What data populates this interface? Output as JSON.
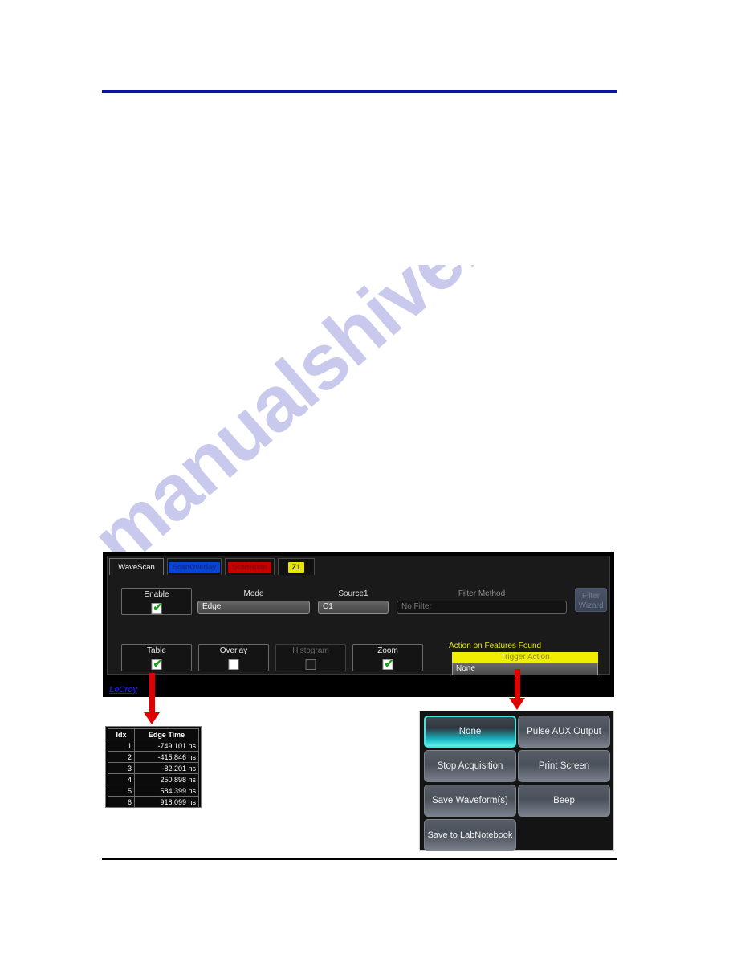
{
  "page": {
    "watermark": "manualshive.com"
  },
  "dialog": {
    "tabs": [
      {
        "label": "WaveScan",
        "style": "active"
      },
      {
        "label": "ScanOverlay",
        "style": "blue"
      },
      {
        "label": "ScanHisto",
        "style": "red"
      },
      {
        "label": "Z1",
        "style": "yellow"
      }
    ],
    "enable": {
      "label": "Enable",
      "checked": "✔"
    },
    "mode": {
      "label": "Mode",
      "value": "Edge"
    },
    "source1": {
      "label": "Source1",
      "value": "C1"
    },
    "filter_method": {
      "label": "Filter Method",
      "value": "No Filter"
    },
    "filter_wizard": {
      "line1": "Filter",
      "line2": "Wizard"
    },
    "view_options": [
      {
        "label": "Table",
        "checked": "✔"
      },
      {
        "label": "Overlay",
        "checked": ""
      },
      {
        "label": "Histogram",
        "checked": ""
      },
      {
        "label": "Zoom",
        "checked": "✔"
      }
    ],
    "action_on_features": {
      "label": "Action on Features Found",
      "header": "Trigger Action",
      "value": "None"
    },
    "logo": "LeCroy"
  },
  "edge_table": {
    "headers": [
      "Idx",
      "Edge Time"
    ],
    "rows": [
      {
        "idx": "1",
        "time": "-749.101 ns"
      },
      {
        "idx": "2",
        "time": "-415.846 ns"
      },
      {
        "idx": "3",
        "time": "-82.201 ns"
      },
      {
        "idx": "4",
        "time": "250.898 ns"
      },
      {
        "idx": "5",
        "time": "584.399 ns"
      },
      {
        "idx": "6",
        "time": "918.099 ns"
      }
    ]
  },
  "action_panel": {
    "buttons": [
      {
        "label": "None",
        "selected": true
      },
      {
        "label": "Pulse AUX Output",
        "selected": false
      },
      {
        "label": "Stop Acquisition",
        "selected": false
      },
      {
        "label": "Print Screen",
        "selected": false
      },
      {
        "label": "Save Waveform(s)",
        "selected": false
      },
      {
        "label": "Beep",
        "selected": false
      },
      {
        "label": "Save to LabNotebook",
        "selected": false
      }
    ]
  },
  "colors": {
    "rule_top": "#0a10a8",
    "arrow": "#e00000",
    "accent_yellow": "#f2ee00",
    "selected_cyan": "#49e4dd",
    "logo_blue": "#1a1ad2"
  }
}
